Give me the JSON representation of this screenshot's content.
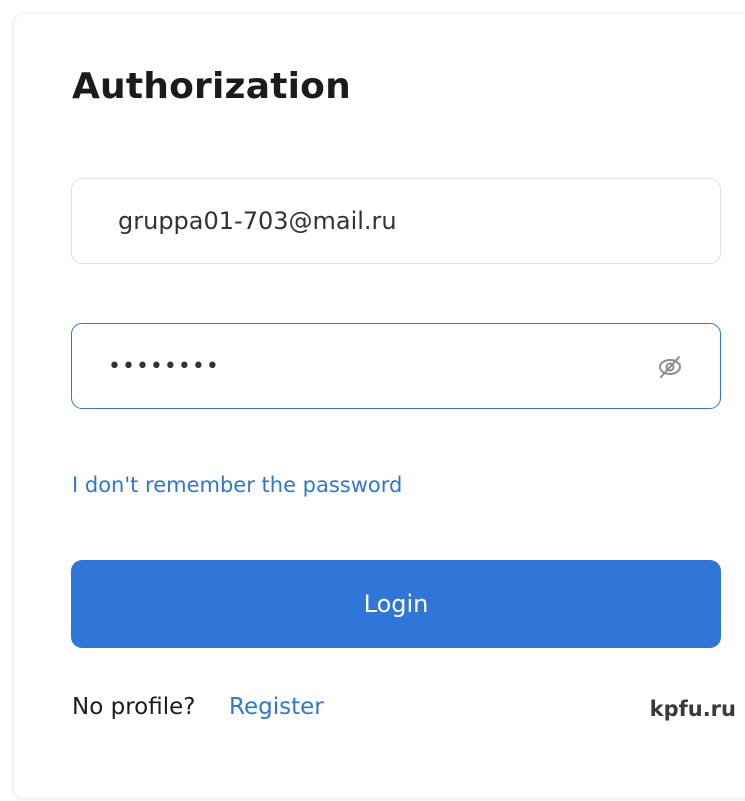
{
  "form": {
    "title": "Authorization",
    "email": {
      "value": "gruppa01-703@mail.ru"
    },
    "password": {
      "value": "••••••••"
    },
    "forgot_link": "I don't remember the password",
    "login_button": "Login",
    "no_profile_text": "No profile?",
    "register_link": "Register",
    "brand": "kpfu.ru"
  },
  "colors": {
    "accent": "#2f76d8",
    "text": "#1b1b1b",
    "border": "#e2e2e2"
  },
  "icons": {
    "password_toggle": "eye-slash-icon"
  }
}
